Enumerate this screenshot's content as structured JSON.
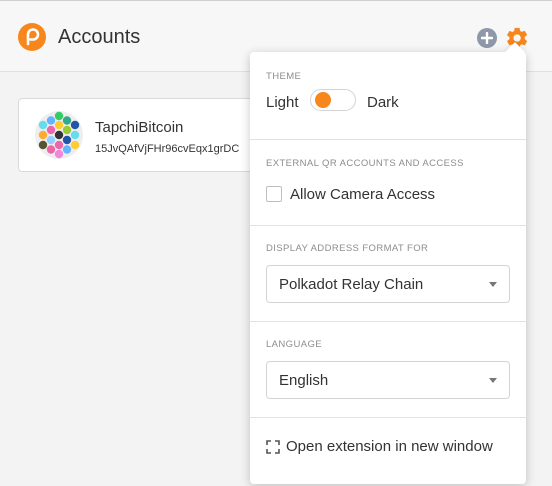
{
  "header": {
    "title": "Accounts",
    "logo_icon": "polkadot-logo-icon",
    "add_icon": "plus-circle-icon",
    "settings_icon": "gear-icon"
  },
  "account": {
    "name": "TapchiBitcoin",
    "address": "15JvQAfVjFHr96cvEqx1grDC",
    "avatar_icon": "identicon"
  },
  "settings": {
    "theme": {
      "title": "THEME",
      "light_label": "Light",
      "dark_label": "Dark",
      "state": "light"
    },
    "camera": {
      "title": "EXTERNAL QR ACCOUNTS AND ACCESS",
      "checkbox_label": "Allow Camera Access",
      "checked": false
    },
    "address_format": {
      "title": "DISPLAY ADDRESS FORMAT FOR",
      "selected": "Polkadot Relay Chain"
    },
    "language": {
      "title": "LANGUAGE",
      "selected": "English"
    },
    "open_window_label": "Open extension in new window"
  },
  "colors": {
    "accent": "#f7861c",
    "muted": "#8d8d8d",
    "add_icon": "#8e98a8"
  }
}
